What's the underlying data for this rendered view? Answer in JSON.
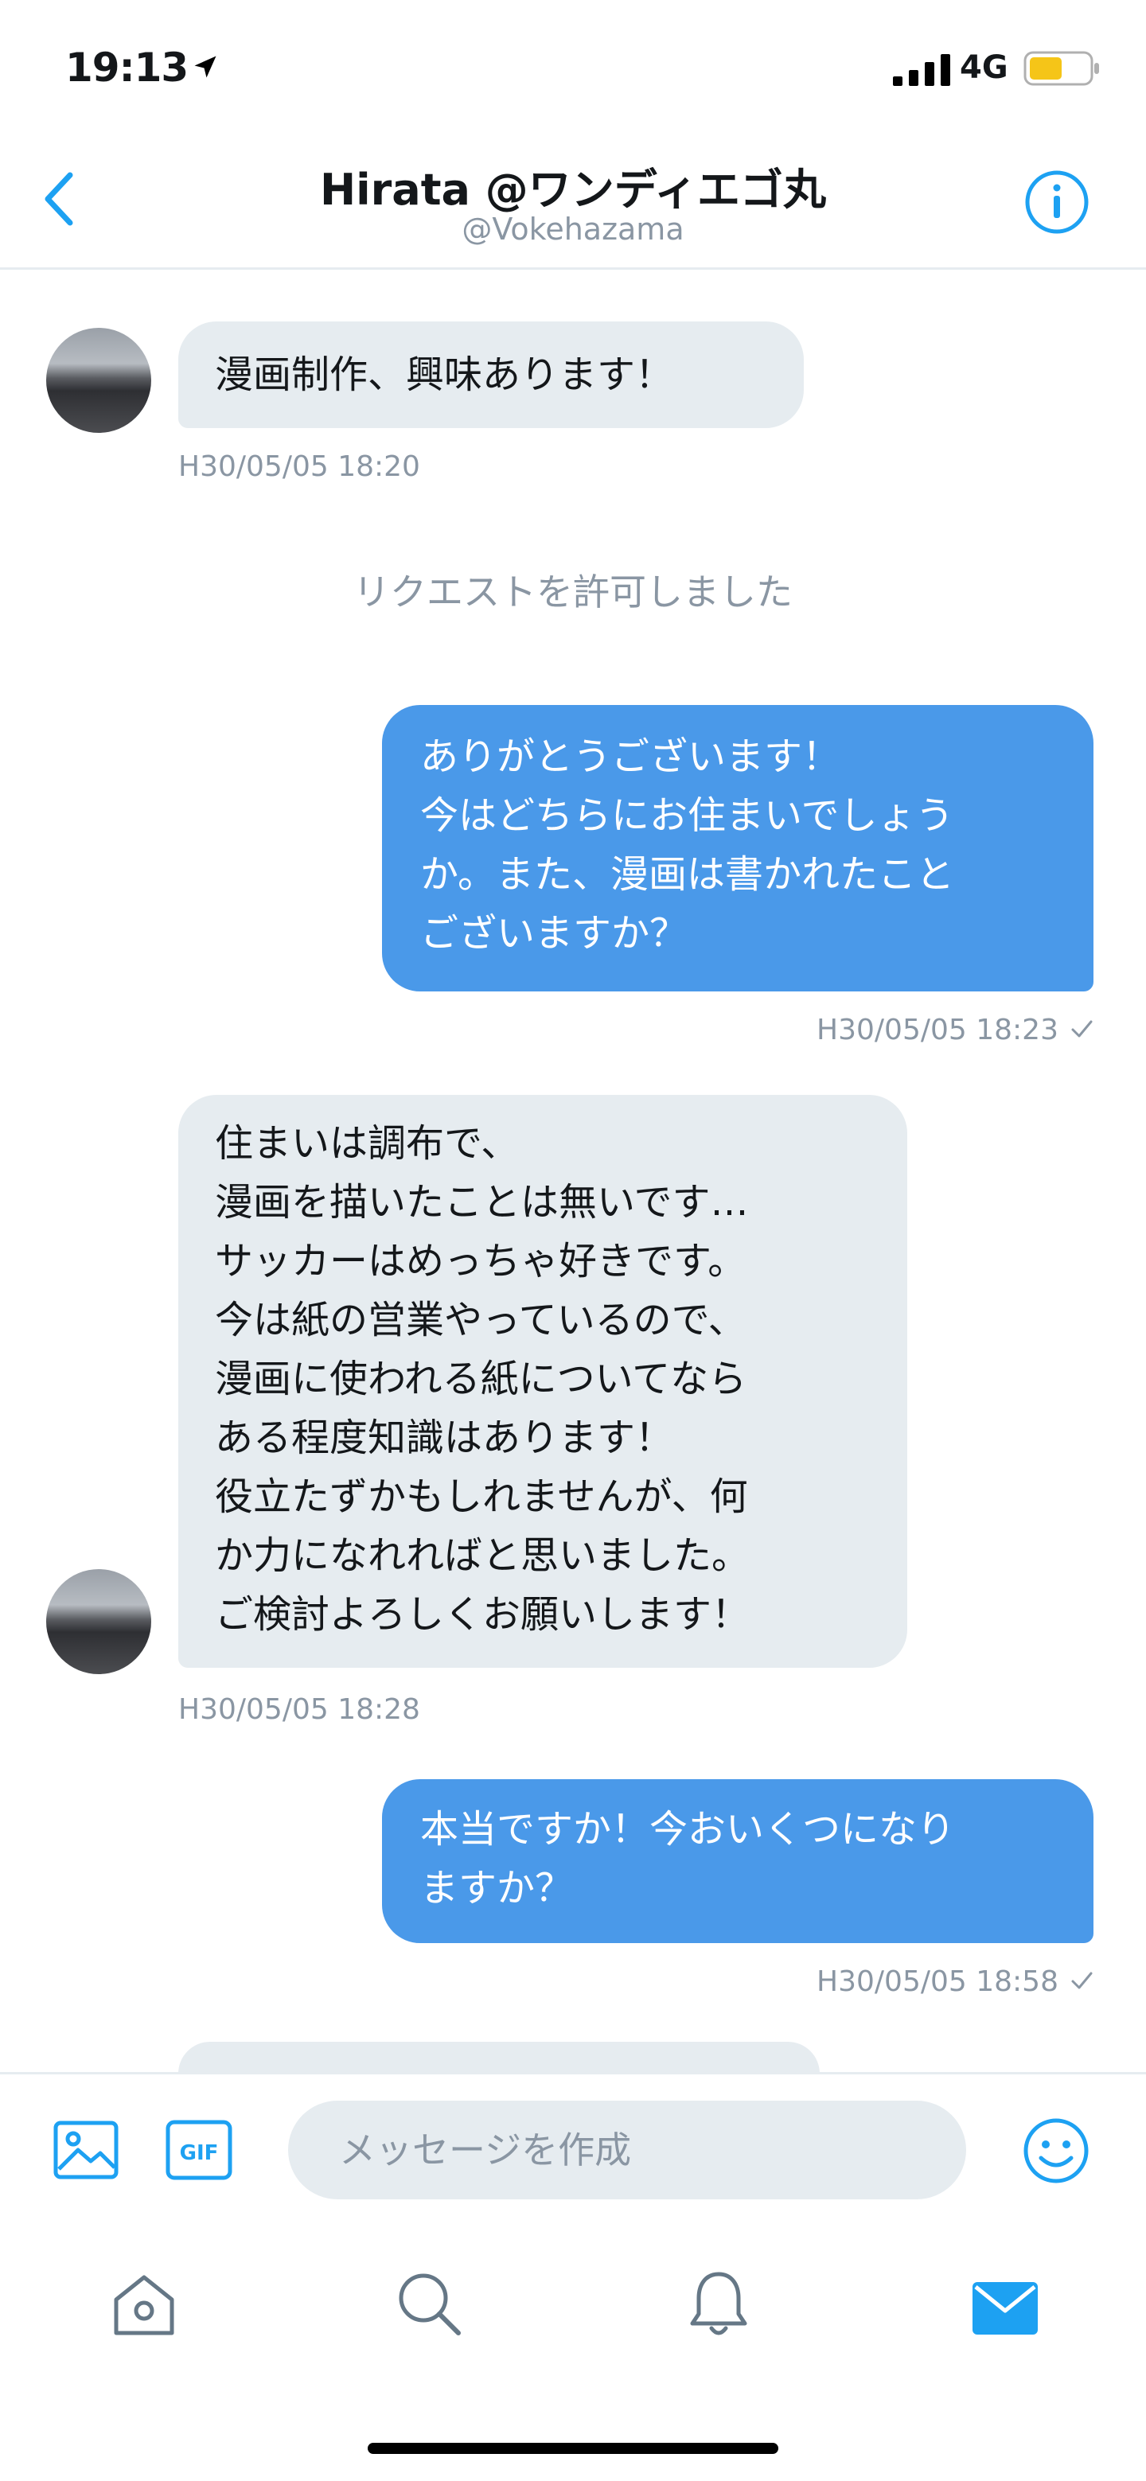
{
  "status_bar": {
    "time": "19:13",
    "network": "4G"
  },
  "header": {
    "title": "Hirata @ワンディエゴ丸",
    "handle": "@Vokehazama"
  },
  "system_message": "リクエストを許可しました",
  "messages": [
    {
      "direction": "incoming",
      "text": "漫画制作、興味あります！",
      "timestamp": "H30/05/05 18:20"
    },
    {
      "direction": "outgoing",
      "text": "ありがとうございます！\n今はどちらにお住まいでしょう\nか。また、漫画は書かれたこと\nございますか？",
      "timestamp": "H30/05/05 18:23"
    },
    {
      "direction": "incoming",
      "text": "住まいは調布で、\n漫画を描いたことは無いです…\nサッカーはめっちゃ好きです。\n今は紙の営業やっているので、\n漫画に使われる紙についてなら\nある程度知識はあります！\n役立たずかもしれませんが、何\nか力になれればと思いました。\nご検討よろしくお願いします！",
      "timestamp": "H30/05/05 18:28"
    },
    {
      "direction": "outgoing",
      "text": "本当ですか！今おいくつになり\nますか？",
      "timestamp": "H30/05/05 18:58"
    }
  ],
  "composer": {
    "placeholder": "メッセージを作成",
    "gif_label": "GIF"
  },
  "colors": {
    "accent": "#1da1f2",
    "outgoing_bubble": "#4a99e9",
    "incoming_bubble": "#e6ecf0",
    "muted_text": "#8a96a3",
    "battery": "#f5c518"
  },
  "icons": {
    "status": [
      "location-arrow-icon",
      "signal-bars-icon",
      "battery-icon"
    ],
    "header": [
      "back-chevron-icon",
      "info-icon"
    ],
    "composer": [
      "image-icon",
      "gif-icon",
      "emoji-icon"
    ],
    "tabs": [
      "home-icon",
      "search-icon",
      "notifications-bell-icon",
      "messages-envelope-icon"
    ]
  }
}
